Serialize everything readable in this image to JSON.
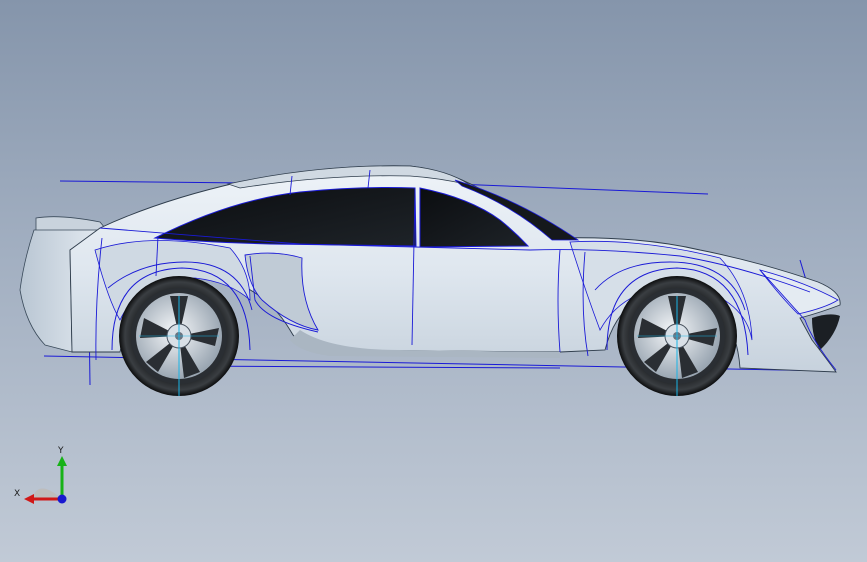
{
  "viewport": {
    "background_top": "#8595ab",
    "background_bottom": "#c1cad6",
    "model": "sports-car-side-view",
    "edge_color": "#1a1ad6"
  },
  "triad": {
    "x_label": "X",
    "y_label": "Y",
    "x_color": "#d01818",
    "y_color": "#17b217",
    "z_color": "#1818d0"
  }
}
